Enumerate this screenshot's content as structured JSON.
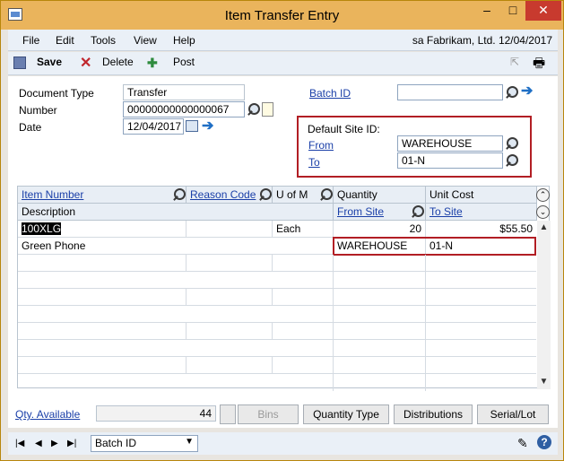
{
  "window": {
    "title": "Item Transfer Entry"
  },
  "titlebar": {
    "minimize": "–",
    "maximize": "□",
    "close": "✕"
  },
  "menu": {
    "items": [
      "File",
      "Edit",
      "Tools",
      "View",
      "Help"
    ],
    "company": "sa  Fabrikam, Ltd.  12/04/2017"
  },
  "toolbar": {
    "save": "Save",
    "delete": "Delete",
    "post": "Post"
  },
  "form": {
    "document_type_label": "Document Type",
    "document_type": "Transfer",
    "number_label": "Number",
    "number": "00000000000000067",
    "date_label": "Date",
    "date": "12/04/2017",
    "batch_id_label": "Batch ID",
    "batch_id": "",
    "default_site_label": "Default Site ID:",
    "from_label": "From",
    "from_value": "WAREHOUSE",
    "to_label": "To",
    "to_value": "01-N"
  },
  "grid": {
    "headers_row1": [
      "Item Number",
      "Reason Code",
      "U of M",
      "Quantity",
      "Unit Cost"
    ],
    "headers_row2": [
      "Description",
      "From Site",
      "To Site"
    ],
    "rows": [
      {
        "item": "100XLG",
        "reason": "",
        "uom": "Each",
        "quantity": "20",
        "unit_cost": "$55.50"
      },
      {
        "description": "Green Phone",
        "from_site": "WAREHOUSE",
        "to_site": "01-N"
      }
    ]
  },
  "footer": {
    "qty_available_label": "Qty. Available",
    "qty_available": "44",
    "bins": "Bins",
    "quantity_type": "Quantity Type",
    "distributions": "Distributions",
    "serial_lot": "Serial/Lot"
  },
  "status": {
    "sort_by": "Batch ID"
  },
  "colors": {
    "titlebar": "#eab45c",
    "accent_red": "#b21e24",
    "link": "#1a3fa8"
  }
}
